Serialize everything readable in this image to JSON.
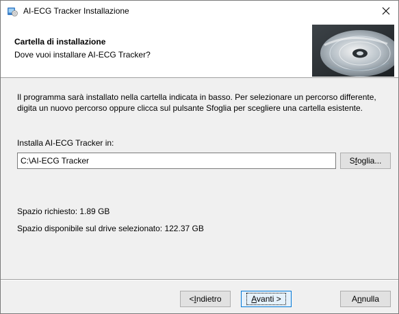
{
  "window": {
    "title": "AI-ECG Tracker Installazione",
    "icons": {
      "app": "installer-icon",
      "close": "close-icon"
    }
  },
  "header": {
    "title": "Cartella di installazione",
    "subtitle": "Dove vuoi installare AI-ECG Tracker?",
    "image": "cd-disc-image"
  },
  "body": {
    "description_line1": "Il programma sarà installato nella cartella indicata in basso. Per selezionare un percorso differente,",
    "description_line2": "digita un nuovo percorso oppure clicca sul pulsante Sfoglia per scegliere una cartella esistente.",
    "install_label": "Installa AI-ECG Tracker in:",
    "install_path": "C:\\AI-ECG Tracker",
    "browse_pre": "S",
    "browse_key": "f",
    "browse_post": "oglia...",
    "space_required": "Spazio richiesto: 1.89 GB",
    "space_available": "Spazio disponibile sul drive selezionato: 122.37 GB"
  },
  "footer": {
    "back_pre": "< ",
    "back_key": "I",
    "back_post": "ndietro",
    "next_pre": "",
    "next_key": "A",
    "next_post": "vanti >",
    "cancel_pre": "A",
    "cancel_key": "n",
    "cancel_post": "nulla"
  }
}
